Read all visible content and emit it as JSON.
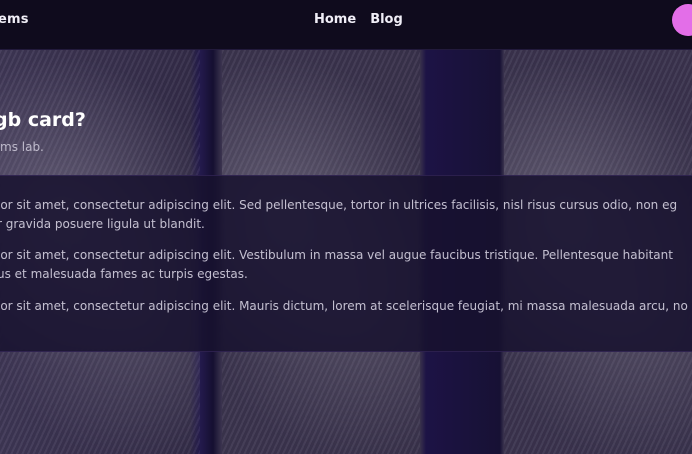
{
  "header": {
    "brand": "ems",
    "nav": [
      {
        "label": "Home"
      },
      {
        "label": "Blog"
      }
    ],
    "avatar_color": "#e36ee8"
  },
  "hero": {
    "title": "gb card?",
    "subtitle": "ms lab."
  },
  "content": {
    "paragraphs": [
      {
        "line1": "lor sit amet, consectetur adipiscing elit. Sed pellentesque, tortor in ultrices facilisis, nisl risus cursus odio, non eg",
        "line2": "r gravida posuere ligula ut blandit."
      },
      {
        "line1": "lor sit amet, consectetur adipiscing elit. Vestibulum in massa vel augue faucibus tristique. Pellentesque habitant",
        "line2": "us et malesuada fames ac turpis egestas."
      },
      {
        "line1": "lor sit amet, consectetur adipiscing elit. Mauris dictum, lorem at scelerisque feugiat, mi massa malesuada arcu, no"
      }
    ]
  },
  "colors": {
    "header_bg": "#0f0b1d",
    "content_bg": "#17112e",
    "text": "#f0eef7",
    "accent": "#e36ee8"
  }
}
